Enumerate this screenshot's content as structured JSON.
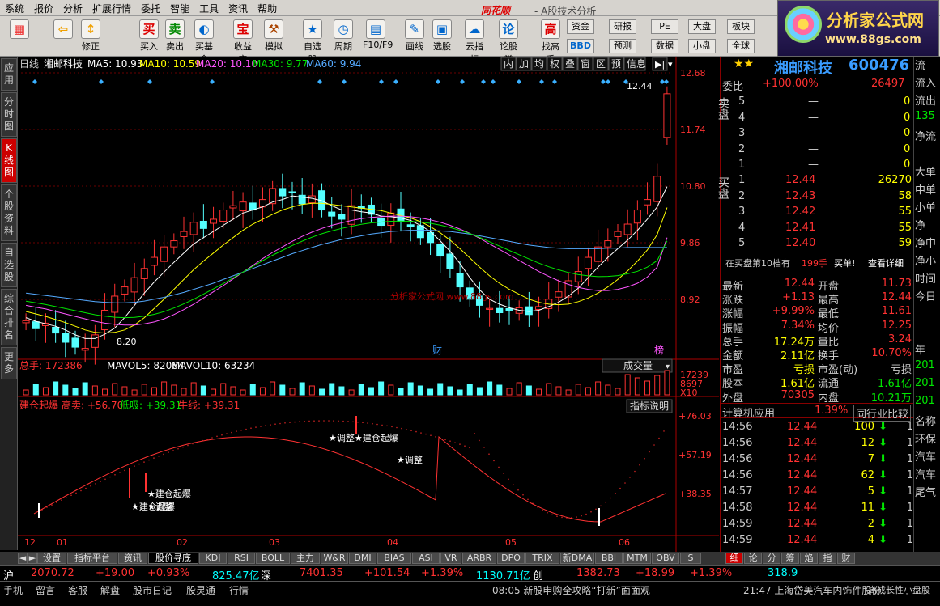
{
  "app": {
    "brand": "同花顺",
    "subtitle": "- A股技术分析"
  },
  "menu": [
    "系统",
    "报价",
    "分析",
    "扩展行情",
    "委托",
    "智能",
    "工具",
    "资讯",
    "帮助"
  ],
  "toolbar": [
    {
      "label": "",
      "icon": "grid-icon",
      "glyph": "▦",
      "color": "#e33"
    },
    {
      "label": "",
      "icon": "back-arrow-icon",
      "glyph": "⇦",
      "color": "#f0a000"
    },
    {
      "label": "修正",
      "icon": "fix-icon",
      "glyph": "↕",
      "color": "#f0a000"
    },
    {
      "label": "买入",
      "icon": "buy-icon",
      "glyph": "买",
      "color": "#d00"
    },
    {
      "label": "卖出",
      "icon": "sell-icon",
      "glyph": "卖",
      "color": "#080"
    },
    {
      "label": "买基金",
      "icon": "fund-icon",
      "glyph": "◐",
      "color": "#06c"
    },
    {
      "label": "收益宝",
      "icon": "treasure-icon",
      "glyph": "宝",
      "color": "#d00"
    },
    {
      "label": "模拟",
      "icon": "hammer-icon",
      "glyph": "⚒",
      "color": "#a40"
    },
    {
      "label": "自选股",
      "icon": "star-folder-icon",
      "glyph": "★",
      "color": "#06c"
    },
    {
      "label": "周期",
      "icon": "clock-icon",
      "glyph": "◷",
      "color": "#06c"
    },
    {
      "label": "F10/F9",
      "icon": "info-icon",
      "glyph": "▤",
      "color": "#06c"
    },
    {
      "label": "画线",
      "icon": "pencil-icon",
      "glyph": "✎",
      "color": "#06c"
    },
    {
      "label": "选股",
      "icon": "filter-icon",
      "glyph": "▣",
      "color": "#06c"
    },
    {
      "label": "云指标",
      "icon": "cloud-icon",
      "glyph": "☁",
      "color": "#06c"
    },
    {
      "label": "论股堂",
      "icon": "forum-icon",
      "glyph": "论",
      "color": "#06c"
    },
    {
      "label": "找高手",
      "icon": "expert-icon",
      "glyph": "高",
      "color": "#d00"
    }
  ],
  "toolbar_small": [
    "资金",
    "BBD",
    "研报",
    "预测",
    "PE",
    "数据",
    "大盘",
    "小盘",
    "板块",
    "全球"
  ],
  "stock": {
    "name": "湘邮科技",
    "code": "600476"
  },
  "kline": {
    "header_period": "日线",
    "header_name": "湘邮科技",
    "ma5": "MA5: 10.93",
    "ma10": "MA10: 10.59",
    "ma20": "MA20: 10.10",
    "ma30": "MA30: 9.77",
    "ma60": "MA60: 9.94",
    "tabs": [
      "内",
      "加",
      "均",
      "权",
      "叠",
      "窗",
      "区",
      "预",
      "信息"
    ],
    "price_ticks": [
      "12.68",
      "11.74",
      "10.80",
      "9.86",
      "8.92"
    ],
    "low_label": "8.20",
    "high_label": "12.44",
    "watermark": "分析家公式网 www.88gs.com",
    "marker_cai": "财",
    "marker_bang": "榜"
  },
  "volume": {
    "label_total": "总手: 172386",
    "mavol5": "MAVOL5: 82084",
    "mavol10": "MAVOL10: 63234",
    "dropdown": "成交量",
    "ticks": [
      "17239",
      "8697",
      "X10"
    ]
  },
  "indicator": {
    "name": "建仓起爆",
    "gaomai": "高卖: +56.70",
    "dixi": "低吸: +39.31",
    "niuxian": "牛线: +39.31",
    "explain": "指标说明",
    "ticks": [
      "+76.03",
      "+57.19",
      "+38.35"
    ],
    "ann": [
      "★调整★建仓起爆",
      "★调整",
      "★建仓起爆",
      "★调整",
      "★建仓起爆"
    ]
  },
  "x_labels": [
    "12",
    "01",
    "02",
    "03",
    "04",
    "05",
    "06"
  ],
  "chart_data": {
    "type": "candlestick",
    "title": "湘邮科技 日线",
    "y_range": [
      8.2,
      12.68
    ],
    "x_categories": [
      "12",
      "01",
      "02",
      "03",
      "04",
      "05",
      "06"
    ],
    "close": [
      8.75,
      8.62,
      8.71,
      8.55,
      8.4,
      8.32,
      8.3,
      8.52,
      8.92,
      9.15,
      9.3,
      9.45,
      9.6,
      9.78,
      9.95,
      10.05,
      10.2,
      10.35,
      10.25,
      10.4,
      10.55,
      10.62,
      10.68,
      10.55,
      10.72,
      10.9,
      10.78,
      10.84,
      10.65,
      10.78,
      10.55,
      10.45,
      10.4,
      10.62,
      10.58,
      10.48,
      10.3,
      10.5,
      10.36,
      10.28,
      10.1,
      10.02,
      9.8,
      9.6,
      9.3,
      9.1,
      9.0,
      8.95,
      8.88,
      8.92,
      8.96,
      8.85,
      8.98,
      9.1,
      9.22,
      9.4,
      9.55,
      9.78,
      9.95,
      10.05,
      10.2,
      10.32,
      10.55,
      10.72,
      11.1,
      12.44
    ],
    "ma5": [
      8.8,
      8.74,
      8.7,
      8.66,
      8.6,
      8.52,
      8.46,
      8.46,
      8.53,
      8.63,
      8.8,
      9.0,
      9.2,
      9.38,
      9.54,
      9.7,
      9.85,
      10.0,
      10.1,
      10.2,
      10.3,
      10.4,
      10.5,
      10.55,
      10.6,
      10.68,
      10.72,
      10.78,
      10.76,
      10.74,
      10.7,
      10.62,
      10.55,
      10.55,
      10.52,
      10.5,
      10.45,
      10.44,
      10.42,
      10.38,
      10.3,
      10.2,
      10.05,
      9.88,
      9.68,
      9.45,
      9.25,
      9.1,
      9.02,
      8.96,
      8.92,
      8.9,
      8.92,
      8.98,
      9.05,
      9.15,
      9.28,
      9.45,
      9.62,
      9.78,
      9.92,
      10.06,
      10.22,
      10.4,
      10.6,
      10.93
    ],
    "ma10": [
      8.9,
      8.86,
      8.82,
      8.77,
      8.72,
      8.66,
      8.6,
      8.56,
      8.55,
      8.56,
      8.6,
      8.68,
      8.8,
      8.95,
      9.1,
      9.26,
      9.42,
      9.58,
      9.72,
      9.85,
      9.98,
      10.1,
      10.22,
      10.32,
      10.4,
      10.48,
      10.55,
      10.6,
      10.64,
      10.66,
      10.66,
      10.64,
      10.62,
      10.6,
      10.58,
      10.56,
      10.54,
      10.5,
      10.46,
      10.42,
      10.36,
      10.28,
      10.18,
      10.06,
      9.92,
      9.77,
      9.62,
      9.48,
      9.36,
      9.26,
      9.18,
      9.1,
      9.05,
      9.02,
      9.01,
      9.02,
      9.06,
      9.12,
      9.2,
      9.3,
      9.42,
      9.56,
      9.72,
      9.9,
      10.15,
      10.59
    ],
    "ma20": [
      9.0,
      8.97,
      8.94,
      8.9,
      8.86,
      8.82,
      8.78,
      8.74,
      8.71,
      8.69,
      8.68,
      8.68,
      8.7,
      8.73,
      8.78,
      8.85,
      8.93,
      9.02,
      9.12,
      9.22,
      9.32,
      9.43,
      9.54,
      9.65,
      9.76,
      9.86,
      9.95,
      10.04,
      10.12,
      10.19,
      10.25,
      10.3,
      10.34,
      10.38,
      10.41,
      10.43,
      10.44,
      10.45,
      10.45,
      10.44,
      10.42,
      10.39,
      10.35,
      10.3,
      10.24,
      10.17,
      10.09,
      10.0,
      9.91,
      9.82,
      9.73,
      9.64,
      9.55,
      9.47,
      9.4,
      9.34,
      9.29,
      9.26,
      9.24,
      9.24,
      9.26,
      9.3,
      9.36,
      9.46,
      9.62,
      10.1
    ],
    "ma60": [
      9.2,
      9.18,
      9.16,
      9.14,
      9.12,
      9.1,
      9.08,
      9.06,
      9.05,
      9.04,
      9.04,
      9.05,
      9.07,
      9.1,
      9.13,
      9.17,
      9.21,
      9.26,
      9.31,
      9.36,
      9.42,
      9.48,
      9.54,
      9.6,
      9.66,
      9.72,
      9.78,
      9.84,
      9.89,
      9.94,
      9.99,
      10.03,
      10.07,
      10.1,
      10.13,
      10.16,
      10.18,
      10.2,
      10.21,
      10.22,
      10.22,
      10.22,
      10.21,
      10.2,
      10.18,
      10.16,
      10.13,
      10.1,
      10.07,
      10.04,
      10.01,
      9.98,
      9.96,
      9.94,
      9.93,
      9.92,
      9.92,
      9.92,
      9.92,
      9.93,
      9.93,
      9.94,
      9.94,
      9.94,
      9.94,
      9.94
    ]
  },
  "quote": {
    "weibi_label": "委比",
    "weibi": "+100.00%",
    "weicha": "26497",
    "sell_label": "卖\n盘",
    "buy_label": "买\n盘",
    "sell": [
      [
        "5",
        "—",
        "0"
      ],
      [
        "4",
        "—",
        "0"
      ],
      [
        "3",
        "—",
        "0"
      ],
      [
        "2",
        "—",
        "0"
      ],
      [
        "1",
        "—",
        "0"
      ]
    ],
    "buy": [
      [
        "1",
        "12.44",
        "26270"
      ],
      [
        "2",
        "12.43",
        "58"
      ],
      [
        "3",
        "12.42",
        "55"
      ],
      [
        "4",
        "12.41",
        "55"
      ],
      [
        "5",
        "12.40",
        "59"
      ]
    ],
    "buy10_text": "在买盘第10档有",
    "buy10_val": "199手",
    "buy10_action": "买单!",
    "buy10_link": "查看详细",
    "rows": [
      [
        "最新",
        "12.44",
        "开盘",
        "11.73"
      ],
      [
        "涨跌",
        "+1.13",
        "最高",
        "12.44"
      ],
      [
        "涨幅",
        "+9.99%",
        "最低",
        "11.61"
      ],
      [
        "振幅",
        "7.34%",
        "均价",
        "12.25"
      ],
      [
        "总手",
        "17.24万",
        "量比",
        "3.24"
      ],
      [
        "金额",
        "2.11亿",
        "换手",
        "10.70%"
      ],
      [
        "市盈",
        "亏损",
        "市盈(动)",
        "亏损"
      ],
      [
        "股本",
        "1.61亿",
        "流通",
        "1.61亿"
      ],
      [
        "外盘",
        "70305",
        "内盘",
        "10.21万"
      ]
    ],
    "app_label": "计算机应用",
    "app_pct": "1.39%",
    "compare": "同行业比较",
    "ticks": [
      [
        "14:56",
        "12.44",
        "100"
      ],
      [
        "14:56",
        "12.44",
        "12"
      ],
      [
        "14:56",
        "12.44",
        "7"
      ],
      [
        "14:56",
        "12.44",
        "62"
      ],
      [
        "14:57",
        "12.44",
        "5"
      ],
      [
        "14:58",
        "12.44",
        "11"
      ],
      [
        "14:59",
        "12.44",
        "2"
      ],
      [
        "14:59",
        "12.44",
        "4"
      ]
    ]
  },
  "farright": [
    "流",
    "流入",
    "流出",
    "135",
    "净流",
    "",
    "大单",
    "中单",
    "小单",
    "净",
    "净中",
    "净小",
    "时间",
    "今日",
    "",
    "",
    "年",
    "201",
    "201",
    "201",
    "名称",
    "环保",
    "汽车",
    "汽车",
    "尾气"
  ],
  "bottom_tabs": [
    "设置",
    "指标平台",
    "资讯",
    "股价寻底",
    "KDJ",
    "RSI",
    "BOLL",
    "主力",
    "W&R",
    "DMI",
    "BIAS",
    "ASI",
    "VR",
    "ARBR",
    "DPO",
    "TRIX",
    "新DMA",
    "BBI",
    "MTM",
    "OBV",
    "S"
  ],
  "right_tabs": [
    "细",
    "论",
    "分",
    "筹",
    "焰",
    "指",
    "财"
  ],
  "indexbar": {
    "sh_label": "沪",
    "sh_val": "2070.72",
    "sh_chg": "+19.00",
    "sh_pct": "+0.93%",
    "sh_amt": "825.47亿",
    "sz_label": "深",
    "sz_val": "7401.35",
    "sz_chg": "+101.54",
    "sz_pct": "+1.39%",
    "sz_amt": "1130.71亿",
    "cy_label": "创",
    "cy_val": "1382.73",
    "cy_chg": "+18.99",
    "cy_pct": "+1.39%",
    "cy_amt": "318.9"
  },
  "statusbar": {
    "items": [
      "手机",
      "留言",
      "客服",
      "解盘",
      "股市日记",
      "股灵通",
      "行情"
    ],
    "news1": "08:05 新股申购全攻略“打新”面面观",
    "news2": "21:47 上海岱美汽车内饰件股份",
    "news3": "高成长性小盘股"
  },
  "vtabs": [
    "应用",
    "分时图",
    "K线图",
    "个股资料",
    "自选股",
    "综合排名",
    "更多"
  ],
  "logo": {
    "title": "分析家公式网",
    "url": "www.88gs.com"
  }
}
